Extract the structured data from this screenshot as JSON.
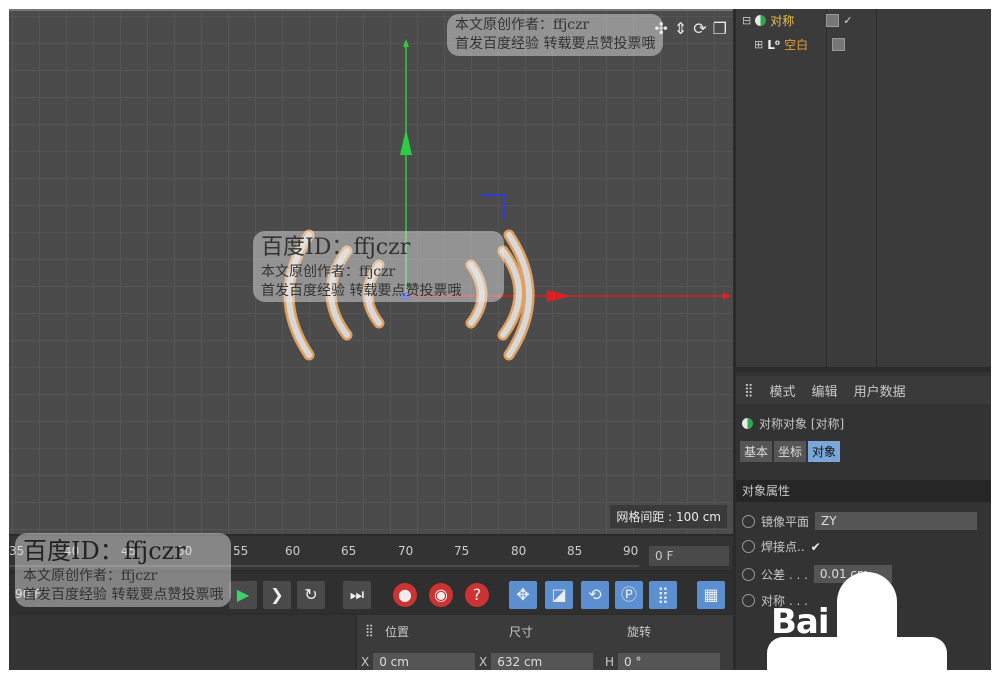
{
  "viewport": {
    "grid_spacing_label": "网格间距 : 100 cm"
  },
  "watermark": {
    "author_line": "本文原创作者：ffjczr",
    "publish_line": "首发百度经验  转载要点赞投票哦",
    "baidu_id": "百度ID：ffjczr"
  },
  "object_manager": {
    "items": [
      {
        "name": "对称"
      },
      {
        "name": "空白"
      }
    ]
  },
  "attributes": {
    "menu": [
      "模式",
      "编辑",
      "用户数据"
    ],
    "object_title": "对称对象 [对称]",
    "tabs": [
      "基本",
      "坐标",
      "对象"
    ],
    "section": "对象属性",
    "mirror_plane_label": "镜像平面",
    "mirror_plane_value": "ZY",
    "weld_label": "焊接点..",
    "weld_check": "✔",
    "tolerance_label": "公差 . . .",
    "tolerance_value": "0.01 cm",
    "symmetry_label": "对称 . . .",
    "baidu_logo": "Bai"
  },
  "timeline": {
    "ticks": [
      "35",
      "40",
      "45",
      "50",
      "55",
      "60",
      "65",
      "70",
      "75",
      "80",
      "85",
      "90"
    ],
    "current_frame": "0 F",
    "end_frame": "90 F"
  },
  "coords": {
    "headers": [
      "位置",
      "尺寸",
      "旋转"
    ],
    "x_pos": "0 cm",
    "x_size": "632 cm",
    "h_rot": "0 °",
    "x_label": "X",
    "h_label": "H"
  }
}
